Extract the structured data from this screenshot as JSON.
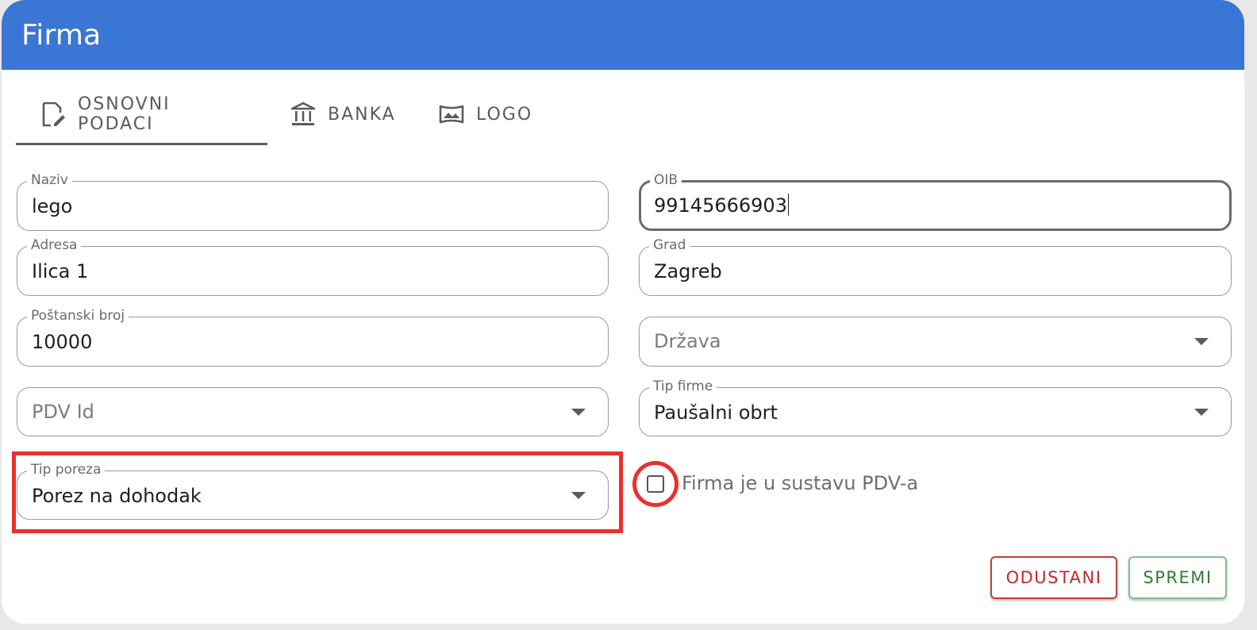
{
  "dialog": {
    "title": "Firma"
  },
  "tabs": [
    {
      "label": "OSNOVNI PODACI",
      "icon": "edit-document-icon",
      "active": true
    },
    {
      "label": "BANKA",
      "icon": "bank-icon",
      "active": false
    },
    {
      "label": "LOGO",
      "icon": "image-icon",
      "active": false
    }
  ],
  "form": {
    "naziv": {
      "label": "Naziv",
      "value": "lego"
    },
    "oib": {
      "label": "OIB",
      "value": "99145666903"
    },
    "adresa": {
      "label": "Adresa",
      "value": "Ilica 1"
    },
    "grad": {
      "label": "Grad",
      "value": "Zagreb"
    },
    "postanski_broj": {
      "label": "Poštanski broj",
      "value": "10000"
    },
    "drzava": {
      "placeholder": "Država"
    },
    "pdv_id": {
      "placeholder": "PDV Id"
    },
    "tip_firme": {
      "label": "Tip firme",
      "value": "Paušalni obrt"
    },
    "tip_poreza": {
      "label": "Tip poreza",
      "value": "Porez na dohodak"
    },
    "pdv_checkbox": {
      "label": "Firma je u sustavu PDV-a",
      "checked": false
    }
  },
  "actions": {
    "cancel_label": "ODUSTANI",
    "save_label": "SPREMI"
  },
  "colors": {
    "header": "#3a76d3",
    "highlight": "#e8312c",
    "cancel": "#c62828",
    "save": "#2e7d32"
  }
}
